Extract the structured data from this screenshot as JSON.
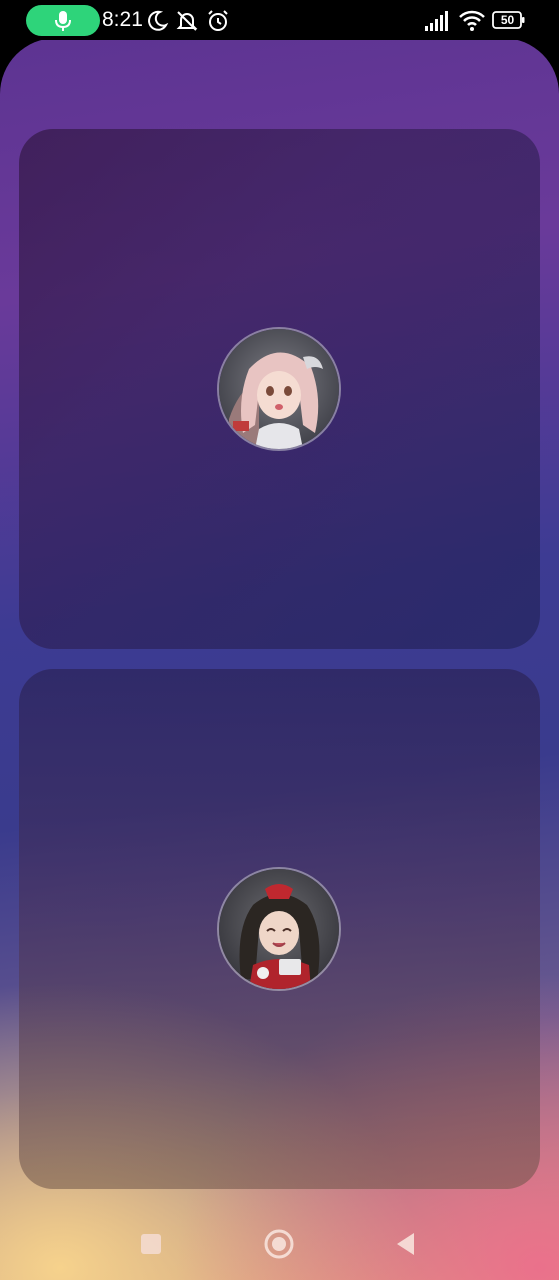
{
  "status_bar": {
    "time": "8:21",
    "battery_level": "50",
    "icons": [
      "microphone-icon",
      "moon-icon",
      "bell-muted-icon",
      "alarm-icon",
      "signal-icon",
      "wifi-icon",
      "battery-icon"
    ]
  },
  "widgets": [
    {
      "avatar_icon": "avatar-image-pink-hair-character"
    },
    {
      "avatar_icon": "avatar-image-dark-hair-character"
    }
  ],
  "navigation_bar": {
    "icons": [
      "recents-square-icon",
      "home-circle-icon",
      "back-triangle-icon"
    ]
  },
  "colors": {
    "mic_pill": "#2ed47a",
    "wallpaper_top": "#5d3492",
    "wallpaper_middle": "#3d3b93",
    "wallpaper_bottom_left": "#f6d28c",
    "wallpaper_bottom_right": "#ec6e8c"
  }
}
